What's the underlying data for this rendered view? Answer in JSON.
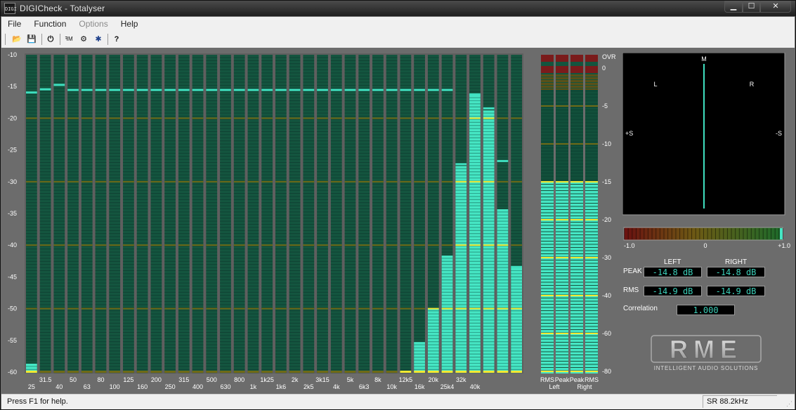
{
  "window": {
    "title": "DIGICheck - Totalyser",
    "icon_text": "DIGI",
    "buttons": [
      "minimize",
      "maximize",
      "close"
    ]
  },
  "menu": [
    {
      "label": "File",
      "enabled": true
    },
    {
      "label": "Function",
      "enabled": true
    },
    {
      "label": "Options",
      "enabled": false
    },
    {
      "label": "Help",
      "enabled": true
    }
  ],
  "toolbar": [
    {
      "name": "open-icon",
      "glyph": "📂"
    },
    {
      "name": "save-icon",
      "glyph": "💾"
    },
    {
      "name": "power-icon",
      "glyph": "⏻"
    },
    {
      "name": "rta-icon",
      "glyph": "ꟻM"
    },
    {
      "name": "settings-icon",
      "glyph": "⚙"
    },
    {
      "name": "bug-icon",
      "glyph": "✱"
    },
    {
      "name": "help-icon",
      "glyph": "?"
    }
  ],
  "spectrum": {
    "db_ticks": [
      "-10",
      "-15",
      "-20",
      "-25",
      "-30",
      "-35",
      "-40",
      "-45",
      "-50",
      "-55",
      "-60"
    ],
    "freq_labels_top": [
      "31.5",
      "50",
      "80",
      "125",
      "200",
      "315",
      "500",
      "800",
      "1k25",
      "2k",
      "3k15",
      "5k",
      "8k",
      "12k5",
      "20k",
      "32k"
    ],
    "freq_labels_bottom": [
      "25",
      "40",
      "63",
      "100",
      "160",
      "250",
      "400",
      "630",
      "1k",
      "1k6",
      "2k5",
      "4k",
      "6k3",
      "10k",
      "16k",
      "25k4",
      "40k"
    ],
    "bands_db": [
      -58.5,
      -60,
      -60,
      -60,
      -60,
      -60,
      -60,
      -60,
      -60,
      -60,
      -60,
      -60,
      -60,
      -60,
      -60,
      -60,
      -60,
      -60,
      -60,
      -60,
      -60,
      -60,
      -60,
      -60,
      -60,
      -60,
      -60,
      -59.8,
      -55.2,
      -49.5,
      -41.3,
      -27.3,
      -16.3,
      -18.5,
      -34.2,
      -43.5
    ],
    "peaks_db": [
      -16,
      -15.5,
      -14.8,
      -15.6,
      -15.6,
      -15.6,
      -15.6,
      -15.6,
      -15.6,
      -15.6,
      -15.6,
      -15.6,
      -15.6,
      -15.6,
      -15.6,
      -15.6,
      -15.6,
      -15.6,
      -15.6,
      -15.6,
      -15.6,
      -15.6,
      -15.6,
      -15.6,
      -15.6,
      -15.6,
      -15.6,
      -15.6,
      -15.6,
      -15.6,
      -15.6,
      -27.3,
      -16.3,
      -18.5,
      -26.8,
      -43.5
    ]
  },
  "level_meters": {
    "scale": [
      "OVR",
      "0",
      "-5",
      "-10",
      "-15",
      "-20",
      "-30",
      "-40",
      "-60",
      "-80"
    ],
    "channel_labels": [
      "RMS",
      "Peak",
      "Peak",
      "RMS"
    ],
    "side_labels": [
      "Left",
      "Right"
    ],
    "level_db": -15
  },
  "goniometer": {
    "labels": {
      "M": "M",
      "L": "L",
      "R": "R",
      "plus_s": "+S",
      "minus_s": "-S"
    }
  },
  "correlation_meter": {
    "min": "-1.0",
    "mid": "0",
    "max": "+1.0",
    "value": 1.0
  },
  "readouts": {
    "left_header": "LEFT",
    "right_header": "RIGHT",
    "peak_label": "PEAK",
    "rms_label": "RMS",
    "peak_left": "-14.8 dB",
    "peak_right": "-14.8 dB",
    "rms_left": "-14.9 dB",
    "rms_right": "-14.9 dB",
    "correlation_label": "Correlation",
    "correlation_value": "1.000"
  },
  "logo": {
    "brand": "RME",
    "tagline": "INTELLIGENT AUDIO SOLUTIONS"
  },
  "status": {
    "help_text": "Press F1 for help.",
    "sample_rate": "SR 88.2kHz"
  },
  "colors": {
    "bar_bg": "#14553f",
    "bar_lit": "#46e6c4",
    "peak_line": "#3fe0c0",
    "yellow_mark": "#f2e832",
    "olive_line": "#6f6a16",
    "ovr_red": "#7a1b1b"
  }
}
